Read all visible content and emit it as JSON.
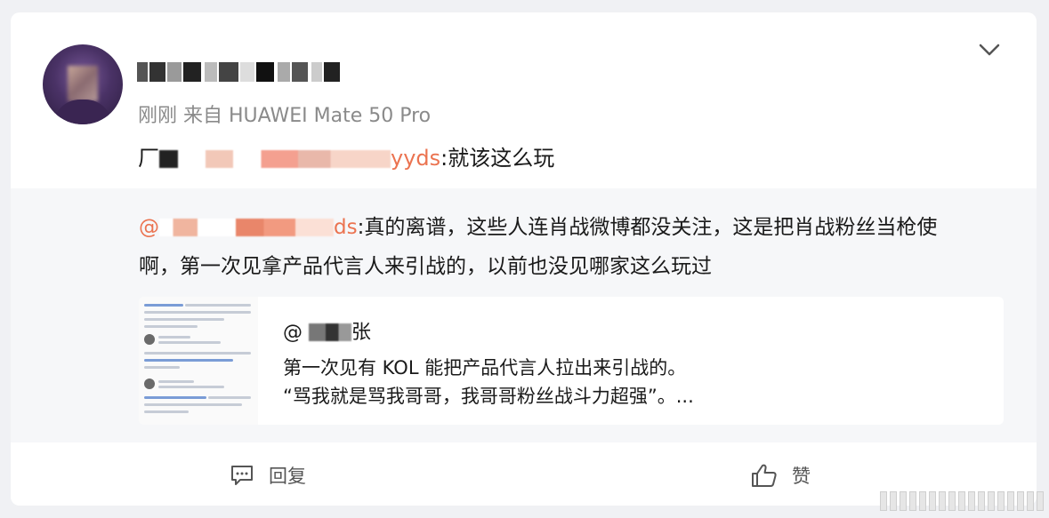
{
  "post": {
    "meta": "刚刚 来自 HUAWEI Mate 50 Pro",
    "text_prefix": "厂",
    "text_visible_tail": "yyds",
    "text_suffix": ":就该这么玩"
  },
  "repost": {
    "mention_prefix": "@",
    "mention_tail": "ds",
    "text": ":真的离谱，这些人连肖战微博都没关注，这是把肖战粉丝当枪使啊，第一次见拿产品代言人来引战的，以前也没见哪家这么玩过"
  },
  "quote": {
    "author_prefix": "@",
    "author_visible": "张",
    "line1": "第一次见有 KOL 能把产品代言人拉出来引战的。",
    "line2": "“骂我就是骂我哥哥，我哥哥粉丝战斗力超强”。..."
  },
  "actions": {
    "reply_label": "回复",
    "like_label": "赞"
  },
  "colors": {
    "link": "#eb7350",
    "card_bg": "#ffffff",
    "repost_bg": "#f6f7f9",
    "meta_text": "#8a8a8a"
  },
  "icons": [
    "chevron-down-icon",
    "comment-icon",
    "thumbs-up-icon"
  ]
}
